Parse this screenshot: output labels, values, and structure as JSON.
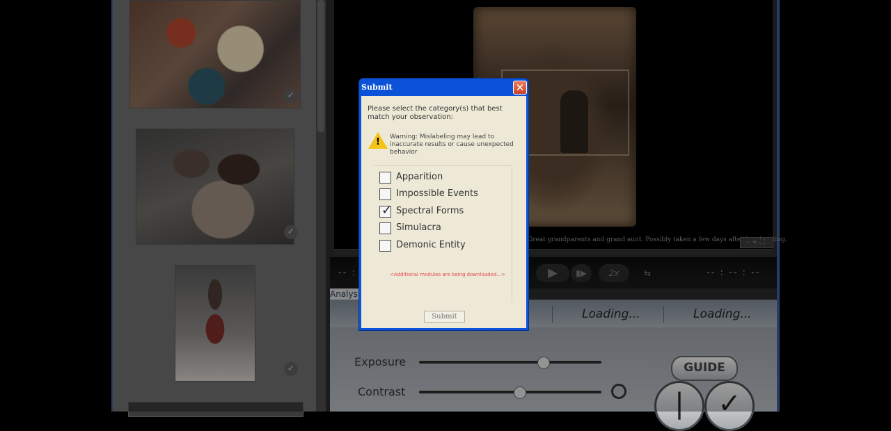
{
  "viewer": {
    "caption": "Great grandparents and grand aunt. Possibly taken a few days after immigrating.",
    "zoom_controls": "–+⛶"
  },
  "transport": {
    "time_left": "-- :",
    "time_right": "-- : -- : --",
    "play_icon": "▶",
    "step_icon": "▮▶",
    "speed_label": "2x",
    "loop_icon": "⇆"
  },
  "analysis": {
    "tab_label": "Analys",
    "loading_1": "Loading...",
    "loading_2": "Loading...",
    "exposure_label": "Exposure",
    "contrast_label": "Contrast",
    "exposure_value": 0.68,
    "contrast_value": 0.55,
    "guide_label": "GUIDE",
    "btn1_glyph": "|",
    "btn2_glyph": "✓"
  },
  "thumbnails": {
    "check_glyph": "✓"
  },
  "dialog": {
    "title": "Submit",
    "close_glyph": "✕",
    "prompt": "Please select the category(s) that best match your observation:",
    "warning_mark": "!",
    "warning": "Warning: Mislabeling may lead to inaccurate results or cause unexpected behavior",
    "options": [
      {
        "label": "Apparition",
        "checked": false
      },
      {
        "label": "Impossible Events",
        "checked": false
      },
      {
        "label": "Spectral Forms",
        "checked": true
      },
      {
        "label": "Simulacra",
        "checked": false
      },
      {
        "label": "Demonic Entity",
        "checked": false
      }
    ],
    "download_note": "<Additional modules are being downloaded...>",
    "submit_label": "Submit"
  },
  "colors": {
    "dialog_title_bar": "#0b52d8",
    "dialog_body": "#ede9d6",
    "warning": "#f3c418",
    "note": "#e24b4b"
  }
}
